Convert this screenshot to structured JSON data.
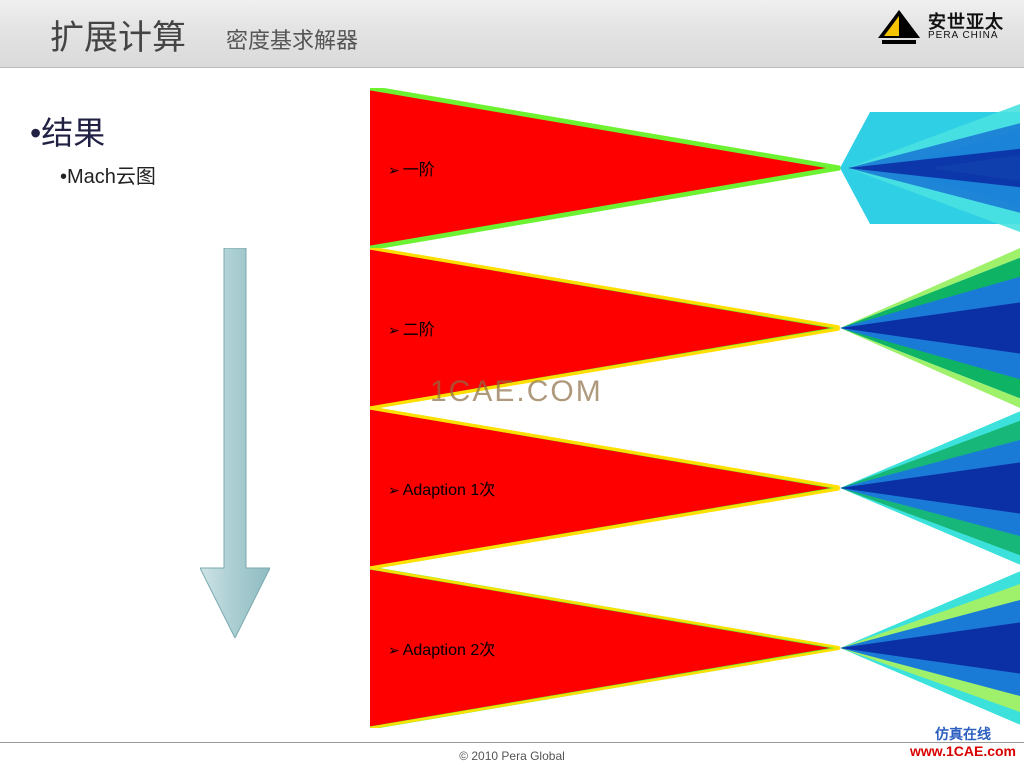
{
  "header": {
    "title": "扩展计算",
    "subtitle": "密度基求解器",
    "logo_cn": "安世亚太",
    "logo_en": "PERA CHINA"
  },
  "body": {
    "bullet": "•结果",
    "subbullet": "•Mach云图",
    "contour_labels": [
      "一阶",
      "二阶",
      "Adaption 1次",
      "Adaption 2次"
    ]
  },
  "watermark": {
    "center": "1CAE.COM",
    "br_line1": "仿真在线",
    "br_line2": "www.1CAE.com"
  },
  "footer": {
    "copyright": "© 2010 Pera Global"
  },
  "icons": {
    "arrow": "down-arrow-icon",
    "logo": "pera-logo-icon"
  }
}
